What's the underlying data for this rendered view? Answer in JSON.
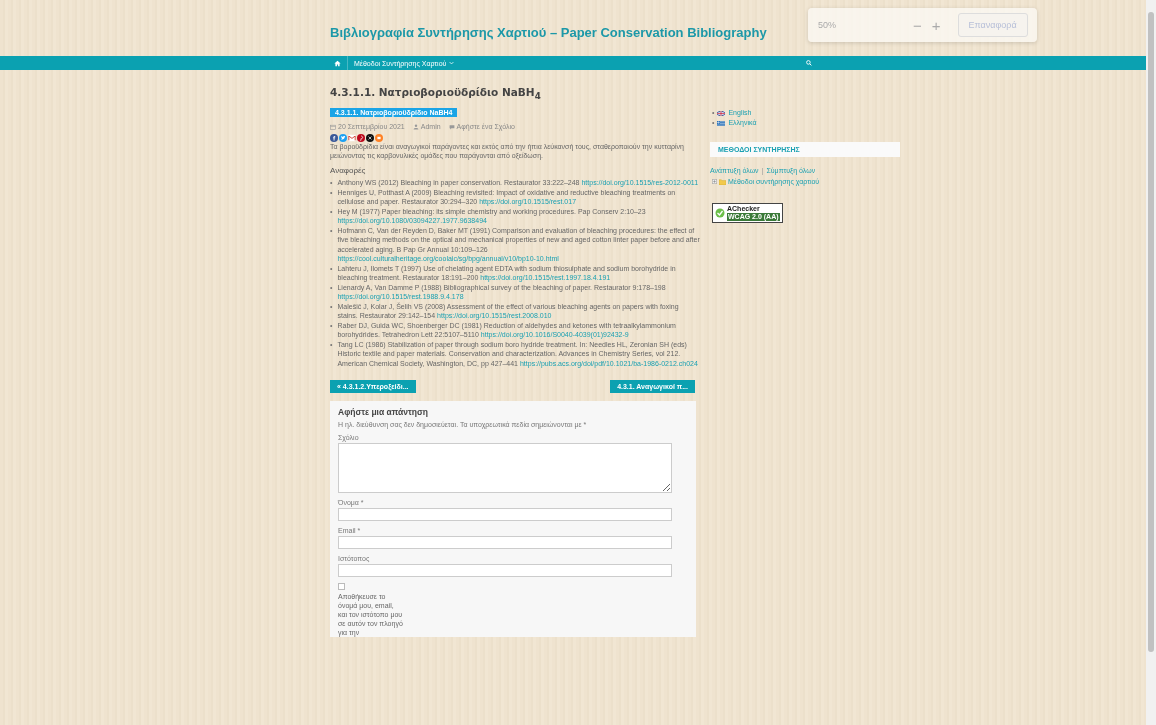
{
  "header": {
    "site_title": "Βιβλιογραφία Συντήρησης Χαρτιού – Paper Conservation Bibliography"
  },
  "zoom_widget": {
    "value": "50%",
    "minus": "−",
    "plus": "+",
    "reset": {
      "label": "Επαναφορά",
      "disabled": true
    }
  },
  "nav": {
    "items": [
      {
        "label": "Μέθοδοι Συντήρησης Χαρτιού",
        "has_submenu": true
      }
    ]
  },
  "post": {
    "title": "4.3.1.1. Νατριοβοριοϋδρίδιο NaBH$_{4}$",
    "tag": "4.3.1.1. Νατριοβοριοϋδρίδιο NaBH4",
    "meta": {
      "date": "20 Σεπτεμβρίου 2021",
      "author": "Admin",
      "comments": "Αφήστε ένα Σχόλιο"
    },
    "share": [
      {
        "kind": "facebook"
      },
      {
        "kind": "twitter"
      },
      {
        "kind": "gmail"
      },
      {
        "kind": "pinterest"
      },
      {
        "kind": "x"
      },
      {
        "kind": "mix"
      }
    ],
    "bullet": "•",
    "intro": "Τα βοροϋδρίδια είναι αναγωγικοί παράγοντες και εκτός από την ήπια λεύκανσή τους, σταθεροποιούν την κυτταρίνη μειώνοντας τις καρβονυλικές ομάδες που παράγονται από οξείδωση.",
    "references_heading": "Αναφορές",
    "references": [
      {
        "text": "Anthony WS (2012) Bleaching in paper conservation. Restaurator 33:222–248",
        "link": "https://doi.org/10.1515/res-2012-0011"
      },
      {
        "text": "Henniges U, Potthast A (2009) Bleaching revisited: Impact of oxidative and reductive bleaching treatments on cellulose and paper. Restaurator 30:294–320",
        "link": "https://doi.org/10.1515/rest.017"
      },
      {
        "text": "Hey M (1977) Paper bleaching: its simple chemistry and working procedures. Pap Conserv 2:10–23",
        "link": "https://doi.org/10.1080/03094227.1977.9638494"
      },
      {
        "text": "Hofmann C, Van der Reyden D, Baker MT (1991) Comparison and evaluation of bleaching procedures: the effect of five bleaching methods on the optical and mechanical properties of new and aged cotton linter paper before and after accelerated aging. B Pap Gr Annual 10:109–126",
        "link": "https://cool.culturalheritage.org/coolaic/sg/bpg/annual/v10/bp10-10.html"
      },
      {
        "text": "Lahteru J, Ilomets T (1997) Use of chelating agent EDTA with sodium thiosulphate and sodium borohydride in bleaching treatment. Restaurator 18:191–200",
        "link": "https://doi.org/10.1515/rest.1997.18.4.191"
      },
      {
        "text": "Lienardy A, Van Damme P (1988) Bibliographical survey of the bleaching of paper. Restaurator 9:178–198",
        "link": "https://doi.org/10.1515/rest.1988.9.4.178"
      },
      {
        "text": "Malešič J, Kolar J, Šelih VS (2008) Assessment of the effect of various bleaching agents on papers with foxing stains. Restaurator 29:142–154",
        "link": "https://doi.org/10.1515/rest.2008.010"
      },
      {
        "text": "Raber DJ, Guida WC, Shoenberger DC (1981) Reduction of aldehydes and ketones with tetraalkylammonium borohydrides. Tetrahedron Lett 22:5107–5110",
        "link": "https://doi.org/10.1016/S0040-4039(01)92432-9"
      },
      {
        "text": "Tang LC (1986) Stabilization of paper through sodium boro hydride treatment. In: Needles HL, Zeronian SH (eds) Historic textile and paper materials. Conservation and characterization. Advances in Chemistry Series, vol 212. American Chemical Society, Washington, DC, pp 427–441",
        "link": "https://pubs.acs.org/doi/pdf/10.1021/ba-1986-0212.ch024"
      }
    ],
    "prev": "« 4.3.1.2.Υπεροξείδι...",
    "next": "4.3.1. Αναγωγικοί π..."
  },
  "comment_form": {
    "title": "Αφήστε μια απάντηση",
    "note": "Η ηλ. διεύθυνση σας δεν δημοσιεύεται. Τα υποχρεωτικά πεδία σημειώνονται με *",
    "fields": [
      {
        "kind": "textarea",
        "label": "Σχόλιο"
      },
      {
        "kind": "input",
        "label": "Όνομα *"
      },
      {
        "kind": "input",
        "label": "Email *"
      },
      {
        "kind": "input",
        "label": "Ιστότοπος"
      }
    ],
    "consent": {
      "checked": false,
      "text": "Αποθήκευσε το όνομά μου, email, και τον ιστότοπο μου σε αυτόν τον πλοηγό για την"
    }
  },
  "sidebar": {
    "bullet": "•",
    "languages": [
      {
        "label": "English",
        "kind": "uk"
      },
      {
        "label": "Ελληνικά",
        "kind": "gr"
      }
    ],
    "widget_title": "ΜΕΘΟΔΟΙ ΣΥΝΤΗΡΗΣΗΣ",
    "expand_all": "Ανάπτυξη όλων",
    "separator": "|",
    "collapse_all": "Σύμπτυξη όλων",
    "tree": [
      {
        "label": "Μέθοδοι συντήρησης χαρτιού",
        "expanded": false
      }
    ],
    "badge": {
      "title": "AChecker",
      "subtitle": "WCAG 2.0 (AA)"
    }
  }
}
